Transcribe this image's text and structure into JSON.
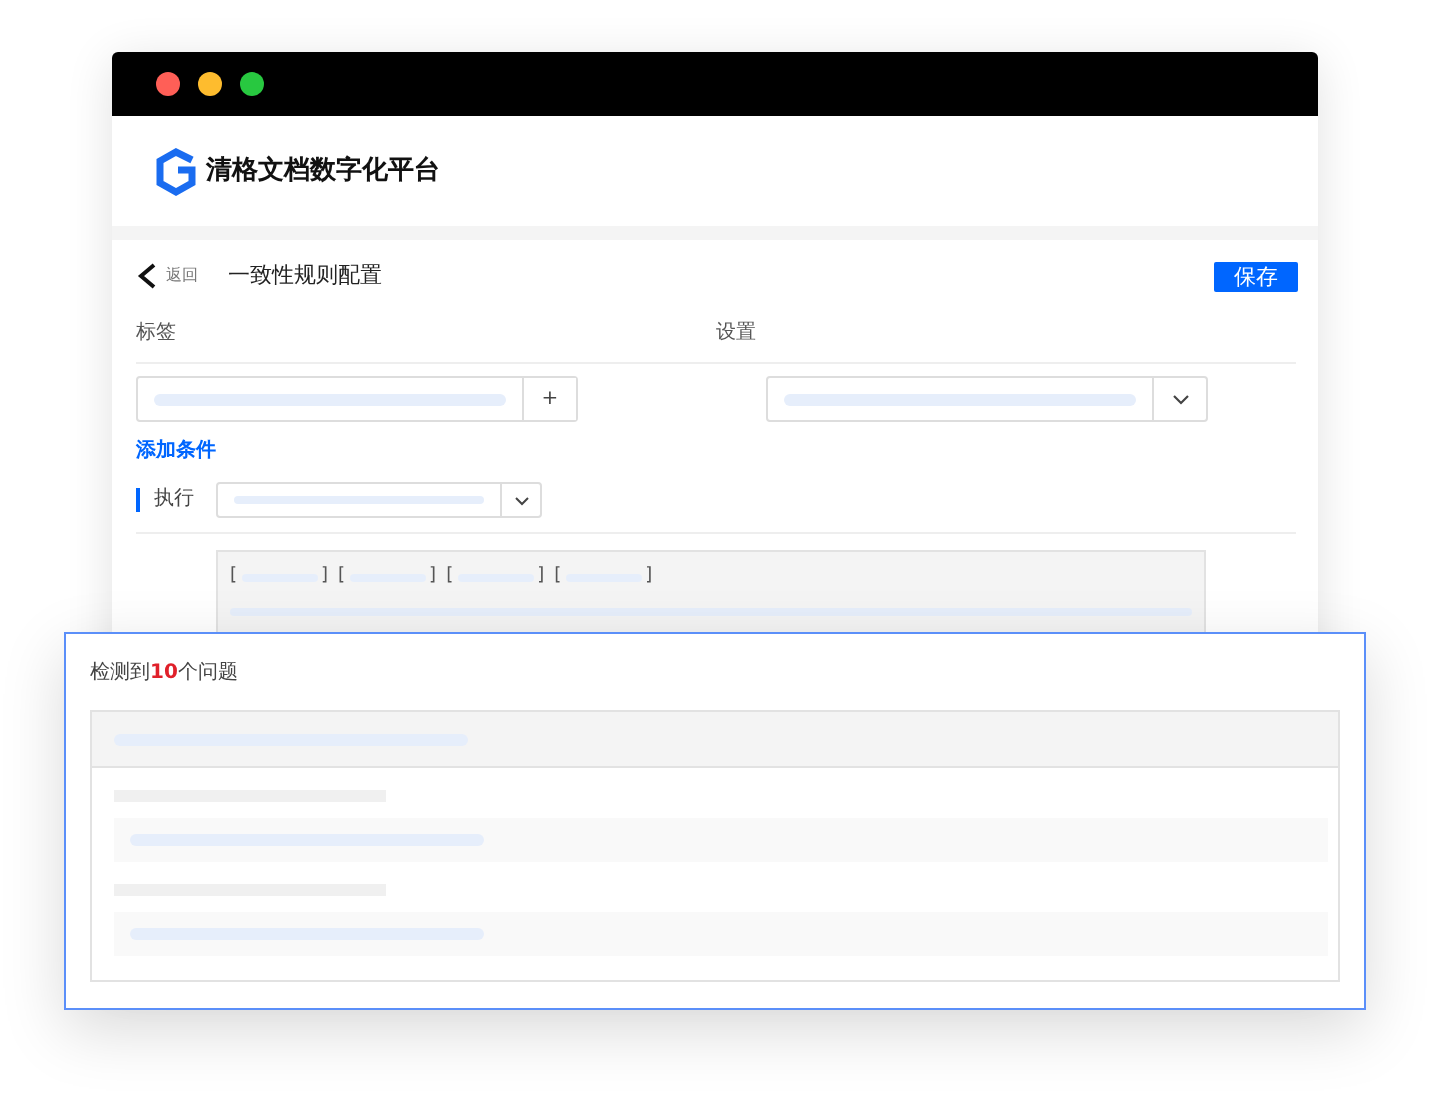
{
  "window": {
    "traffic_lights": [
      {
        "color": "#ff5f57"
      },
      {
        "color": "#febc2e"
      },
      {
        "color": "#28c840"
      }
    ]
  },
  "header": {
    "brand": "清格文档数字化平台"
  },
  "toolbar": {
    "back_label": "返回",
    "title": "一致性规则配置",
    "save_button": "保存"
  },
  "form": {
    "columns": [
      "标签",
      "设置"
    ],
    "add_button": "+",
    "add_condition": "添加条件",
    "execute_label": "执行",
    "tokens": [
      {
        "open": "[",
        "close": "]"
      },
      {
        "open": "[",
        "close": "]"
      },
      {
        "open": "[",
        "close": "]"
      },
      {
        "open": "[",
        "close": "]"
      }
    ]
  },
  "result": {
    "summary": "检测到**10**个问题"
  }
}
